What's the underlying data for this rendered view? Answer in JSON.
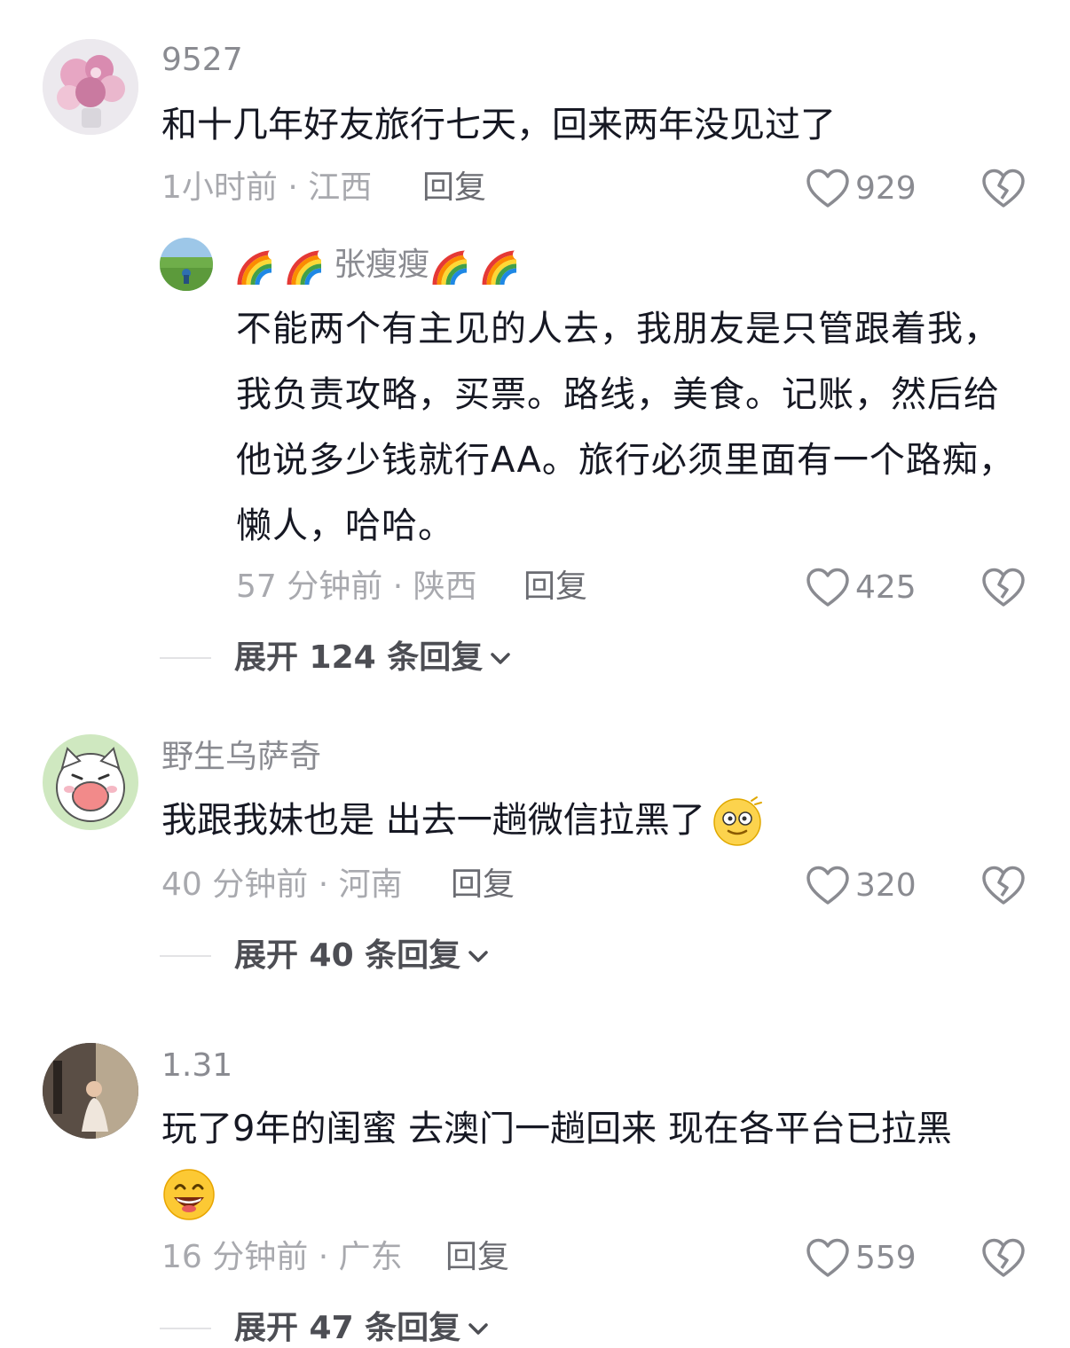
{
  "comments": [
    {
      "username": "9527",
      "text": "和十几年好友旅行七天，回来两年没见过了",
      "time_location": "1小时前 · 江西",
      "reply_label": "回复",
      "likes": "929",
      "avatar": "flower-avatar",
      "replies": [
        {
          "username": "张瘦瘦",
          "username_decoration": "rainbow-emoji",
          "text": "不能两个有主见的人去，我朋友是只管跟着我，我负责攻略，买票。路线，美食。记账，然后给他说多少钱就行AA。旅行必须里面有一个路痴，懒人，哈哈。",
          "time_location": "57 分钟前 · 陕西",
          "reply_label": "回复",
          "likes": "425",
          "avatar": "grass-field-avatar"
        }
      ],
      "expand_label": "展开 124 条回复"
    },
    {
      "username": "野生乌萨奇",
      "text": "我跟我妹也是 出去一趟微信拉黑了",
      "text_emoji": "dizzy-face-emoji",
      "time_location": "40 分钟前 · 河南",
      "reply_label": "回复",
      "likes": "320",
      "avatar": "cartoon-cat-avatar",
      "expand_label": "展开 40 条回复"
    },
    {
      "username": "1.31",
      "text": "玩了9年的闺蜜 去澳门一趟回来 现在各平台已拉黑",
      "text_emoji": "grinning-face-emoji",
      "time_location": "16 分钟前 · 广东",
      "reply_label": "回复",
      "likes": "559",
      "avatar": "person-photo-avatar",
      "expand_label": "展开 47 条回复"
    }
  ]
}
